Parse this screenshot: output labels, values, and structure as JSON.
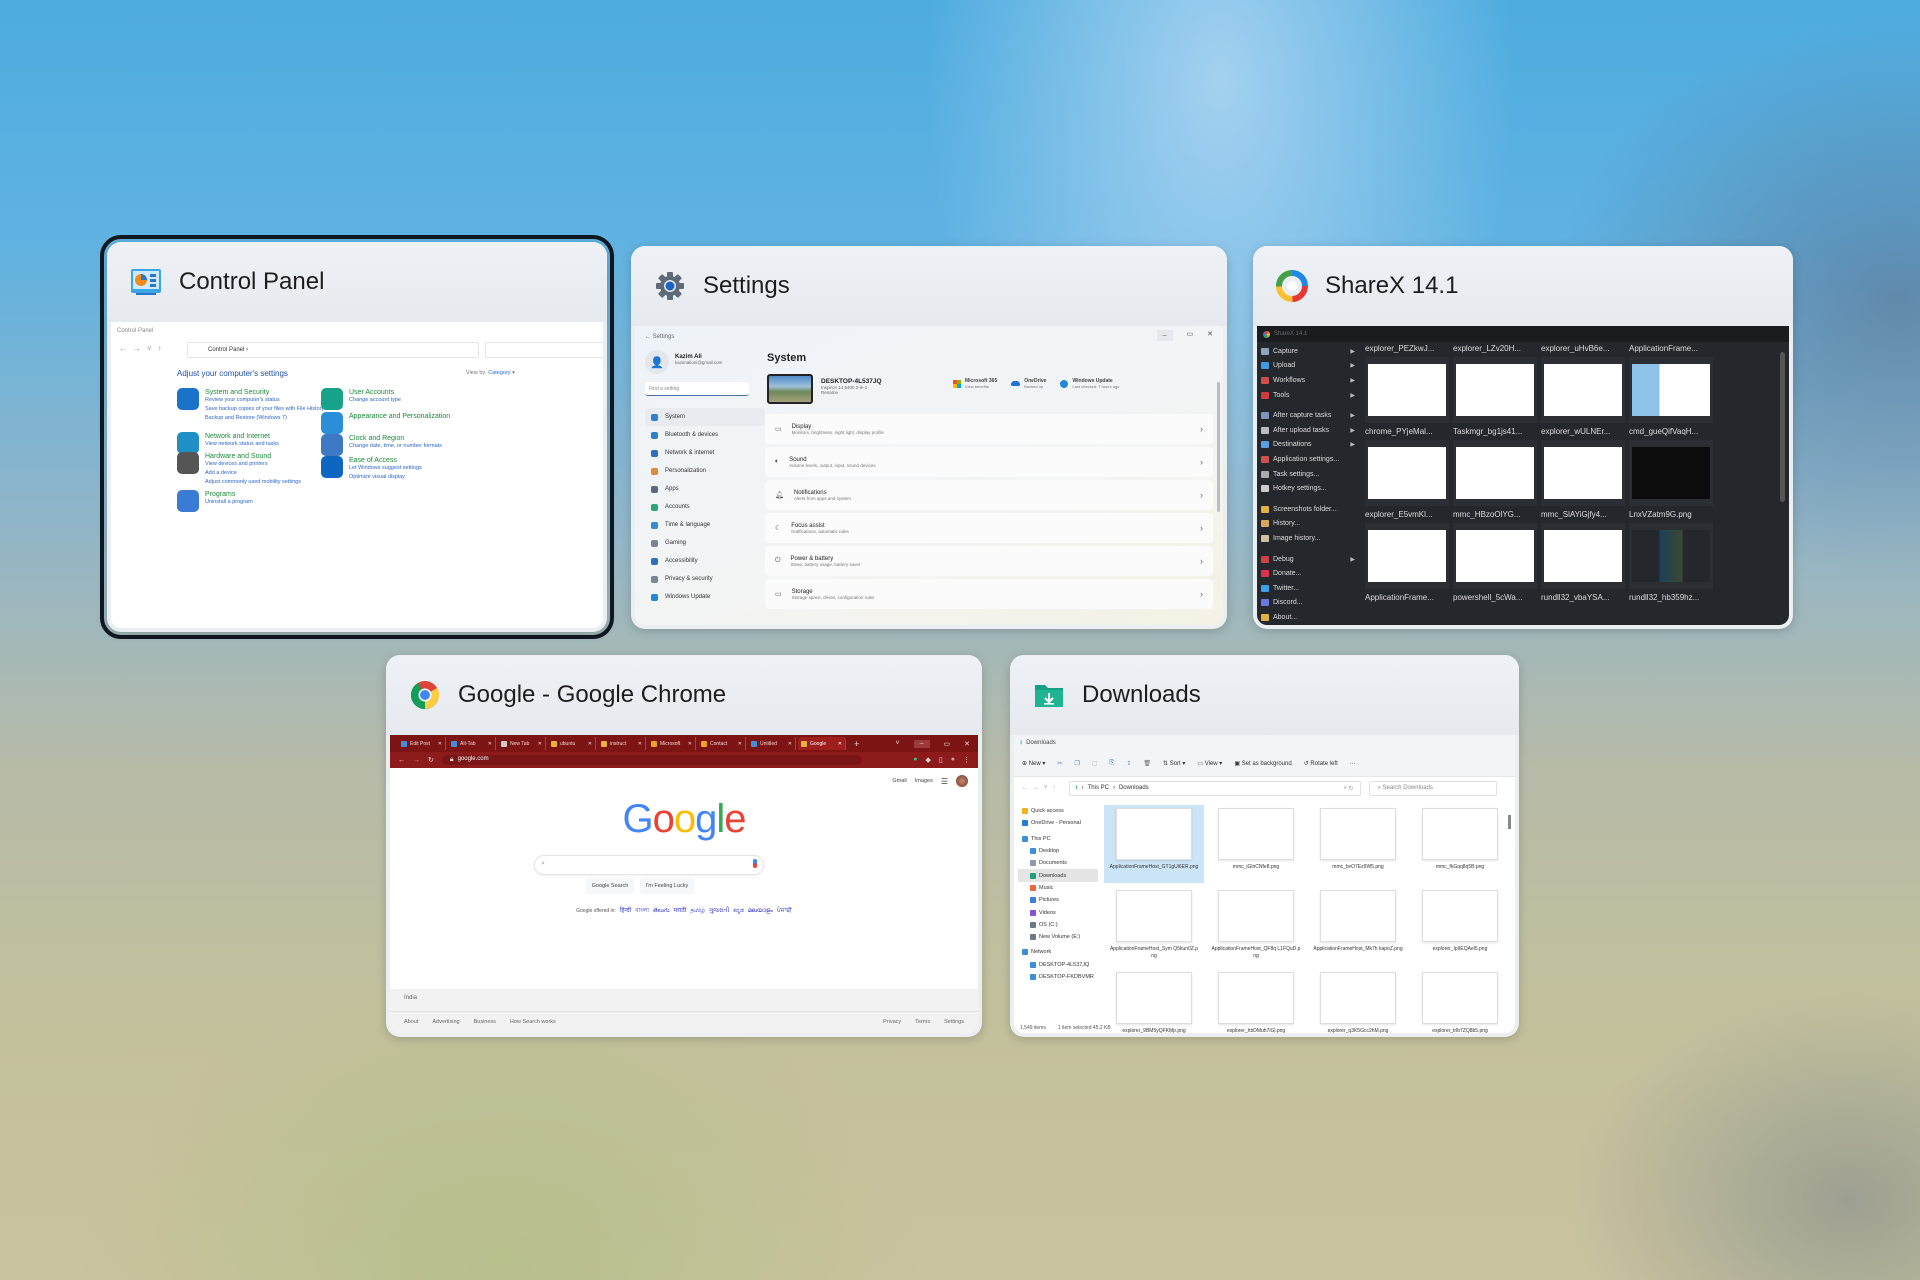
{
  "task_switcher": {
    "windows": [
      {
        "id": "control-panel",
        "title": "Control Panel",
        "selected": true
      },
      {
        "id": "settings",
        "title": "Settings",
        "selected": false
      },
      {
        "id": "sharex",
        "title": "ShareX 14.1",
        "selected": false
      },
      {
        "id": "chrome",
        "title": "Google - Google Chrome",
        "selected": false
      },
      {
        "id": "downloads",
        "title": "Downloads",
        "selected": false
      }
    ]
  },
  "control_panel": {
    "window_title": "Control Panel",
    "breadcrumb": "Control Panel",
    "heading": "Adjust your computer's settings",
    "view_by_label": "View by:",
    "view_by_value": "Category",
    "categories": [
      {
        "name": "System and Security",
        "color": "#1a73c9",
        "links": [
          "Review your computer's status",
          "Save backup copies of your files with File History",
          "Backup and Restore (Windows 7)"
        ]
      },
      {
        "name": "Network and Internet",
        "color": "#1f8fc6",
        "links": [
          "View network status and tasks"
        ]
      },
      {
        "name": "Hardware and Sound",
        "color": "#555555",
        "links": [
          "View devices and printers",
          "Add a device",
          "Adjust commonly used mobility settings"
        ]
      },
      {
        "name": "Programs",
        "color": "#3a7bd5",
        "links": [
          "Uninstall a program"
        ]
      },
      {
        "name": "User Accounts",
        "color": "#17a28a",
        "links": [
          "Change account type"
        ]
      },
      {
        "name": "Appearance and Personalization",
        "color": "#2a8fd8",
        "links": []
      },
      {
        "name": "Clock and Region",
        "color": "#3c78c3",
        "links": [
          "Change date, time, or number formats"
        ]
      },
      {
        "name": "Ease of Access",
        "color": "#0c66c2",
        "links": [
          "Let Windows suggest settings",
          "Optimize visual display"
        ]
      }
    ]
  },
  "settings": {
    "window_title": "Settings",
    "user_name": "Kazim Ali",
    "user_email": "kazimalioni@gmail.com",
    "search_placeholder": "Find a setting",
    "page_title": "System",
    "device_name": "DESKTOP-4L537JQ",
    "device_model": "Inspiron 14 5400 2-in-1",
    "device_rename": "Rename",
    "tiles": [
      {
        "name": "Microsoft 365",
        "sub": "View benefits"
      },
      {
        "name": "OneDrive",
        "sub": "Backed up"
      },
      {
        "name": "Windows Update",
        "sub": "Last checked: 7 hours ago"
      }
    ],
    "nav": [
      {
        "label": "System",
        "color": "#2f7fd1",
        "active": true
      },
      {
        "label": "Bluetooth & devices",
        "color": "#2f7fd1"
      },
      {
        "label": "Network & internet",
        "color": "#2f6fc0"
      },
      {
        "label": "Personalization",
        "color": "#e08a3a"
      },
      {
        "label": "Apps",
        "color": "#5a6a80"
      },
      {
        "label": "Accounts",
        "color": "#2aa677"
      },
      {
        "label": "Time & language",
        "color": "#2f8fd1"
      },
      {
        "label": "Gaming",
        "color": "#7a8595"
      },
      {
        "label": "Accessibility",
        "color": "#2f6fc0"
      },
      {
        "label": "Privacy & security",
        "color": "#7a8595"
      },
      {
        "label": "Windows Update",
        "color": "#1f88d8"
      }
    ],
    "rows": [
      {
        "title": "Display",
        "sub": "Monitors, brightness, night light, display profile"
      },
      {
        "title": "Sound",
        "sub": "Volume levels, output, input, sound devices"
      },
      {
        "title": "Notifications",
        "sub": "Alerts from apps and system"
      },
      {
        "title": "Focus assist",
        "sub": "Notifications, automatic rules"
      },
      {
        "title": "Power & battery",
        "sub": "Sleep, battery usage, battery saver"
      },
      {
        "title": "Storage",
        "sub": "Storage space, drives, configuration rules"
      }
    ]
  },
  "sharex": {
    "window_title": "ShareX 14.1",
    "menu": [
      {
        "label": "Capture",
        "color": "#8fa3bf",
        "arrow": true
      },
      {
        "label": "Upload",
        "color": "#3e9be0",
        "arrow": true
      },
      {
        "label": "Workflows",
        "color": "#d04d4d",
        "arrow": true
      },
      {
        "label": "Tools",
        "color": "#d03a3a",
        "arrow": true
      },
      {
        "sep": true
      },
      {
        "label": "After capture tasks",
        "color": "#7a96c0",
        "arrow": true
      },
      {
        "label": "After upload tasks",
        "color": "#bbbbbb",
        "arrow": true
      },
      {
        "label": "Destinations",
        "color": "#5aa0e0",
        "arrow": true
      },
      {
        "label": "Application settings...",
        "color": "#d05050"
      },
      {
        "label": "Task settings...",
        "color": "#aaaaaa"
      },
      {
        "label": "Hotkey settings...",
        "color": "#cccccc"
      },
      {
        "sep": true
      },
      {
        "label": "Screenshots folder...",
        "color": "#e0b040"
      },
      {
        "label": "History...",
        "color": "#d9a860"
      },
      {
        "label": "Image history...",
        "color": "#d0c0a0"
      },
      {
        "sep": true
      },
      {
        "label": "Debug",
        "color": "#d04040",
        "arrow": true
      },
      {
        "label": "Donate...",
        "color": "#e03050"
      },
      {
        "label": "Twitter...",
        "color": "#3ba0e8"
      },
      {
        "label": "Discord...",
        "color": "#6a78e0"
      },
      {
        "label": "About...",
        "color": "#e0b040"
      }
    ],
    "thumbnails": [
      "explorer_PEZkwJ...",
      "explorer_LZv20H...",
      "explorer_uHvB6e...",
      "ApplicationFrame...",
      "chrome_PYjeMal...",
      "Taskmgr_bg1js41...",
      "explorer_wULNEr...",
      "cmd_gueQifVaqH...",
      "explorer_E5vmKl...",
      "mmc_HBzoOlYG...",
      "mmc_SlAYiGjfy4...",
      "LnxVZatm9G.png",
      "ApplicationFrame...",
      "powershell_5cWa...",
      "rundll32_vbaYSA...",
      "rundll32_hb359hz..."
    ]
  },
  "chrome": {
    "window_title": "Google - Google Chrome",
    "tabs": [
      {
        "label": "Edit Post",
        "color": "#3e8fe0"
      },
      {
        "label": "Alt-Tab",
        "color": "#3e8fe0"
      },
      {
        "label": "New Tab",
        "color": "#cccccc"
      },
      {
        "label": "ubuntu",
        "color": "#e8b040"
      },
      {
        "label": "instruct",
        "color": "#e8b040"
      },
      {
        "label": "Microsoft",
        "color": "#f2a020"
      },
      {
        "label": "Contact",
        "color": "#f2a020"
      },
      {
        "label": "Untitled",
        "color": "#3e8fe0"
      },
      {
        "label": "Google",
        "color": "#e8b040",
        "active": true
      }
    ],
    "url": "google.com",
    "top_links": [
      "Gmail",
      "Images"
    ],
    "logo": [
      {
        "ch": "G",
        "color": "#4285f4"
      },
      {
        "ch": "o",
        "color": "#ea4335"
      },
      {
        "ch": "o",
        "color": "#fbbc05"
      },
      {
        "ch": "g",
        "color": "#4285f4"
      },
      {
        "ch": "l",
        "color": "#34a853"
      },
      {
        "ch": "e",
        "color": "#ea4335"
      }
    ],
    "search_button": "Google Search",
    "lucky_button": "I'm Feeling Lucky",
    "offered_in": "Google offered in:",
    "languages": [
      "हिन्दी",
      "বাংলা",
      "తెలుగు",
      "मराठी",
      "தமிழ்",
      "ગુજરાતી",
      "ಕನ್ನಡ",
      "മലയാളം",
      "ਪੰਜਾਬੀ"
    ],
    "country": "India",
    "footer_left": [
      "About",
      "Advertising",
      "Business",
      "How Search works"
    ],
    "footer_right": [
      "Privacy",
      "Terms",
      "Settings"
    ]
  },
  "downloads": {
    "window_title": "Downloads",
    "toolbar": {
      "new": "New",
      "sort": "Sort",
      "view": "View",
      "set_bg": "Set as background",
      "rotate": "Rotate left",
      "more": "···"
    },
    "path": [
      "This PC",
      "Downloads"
    ],
    "search_placeholder": "Search Downloads",
    "sidebar": [
      {
        "label": "Quick access",
        "color": "#f2b01e"
      },
      {
        "label": "OneDrive - Personal",
        "color": "#1f7fd8"
      },
      {
        "label": "This PC",
        "color": "#3a8fd8"
      },
      {
        "label": "Desktop",
        "color": "#3a8fd8",
        "indent": true
      },
      {
        "label": "Documents",
        "color": "#8a9aaa",
        "indent": true
      },
      {
        "label": "Downloads",
        "color": "#1aa07a",
        "indent": true,
        "active": true
      },
      {
        "label": "Music",
        "color": "#e86a3a",
        "indent": true
      },
      {
        "label": "Pictures",
        "color": "#3a7fd8",
        "indent": true
      },
      {
        "label": "Videos",
        "color": "#8a4fd8",
        "indent": true
      },
      {
        "label": "OS (C:)",
        "color": "#6a7a8a",
        "indent": true
      },
      {
        "label": "New Volume (E:)",
        "color": "#6a7a8a",
        "indent": true
      },
      {
        "label": "Network",
        "color": "#3a8fd8"
      },
      {
        "label": "DESKTOP-4L537JQ",
        "color": "#3a8fd8",
        "indent": true
      },
      {
        "label": "DESKTOP-FKDBVMR",
        "color": "#3a8fd8",
        "indent": true
      }
    ],
    "files": [
      {
        "name": "ApplicationFrameHost_GT1gUi6ER.png",
        "selected": true
      },
      {
        "name": "mmc_iGlnCNfe8.png"
      },
      {
        "name": "mmc_bvO7Ez9W5.png"
      },
      {
        "name": "mmc_fkGqq8q5B.png"
      },
      {
        "name": "ApplicationFrameHost_Sym Q5kun0Z.png"
      },
      {
        "name": "ApplicationFrameHost_QF8q L1FQuD.png"
      },
      {
        "name": "ApplicationFrameHost_Mk7h kapoZ.png"
      },
      {
        "name": "explorer_Ip9EQAel5.png"
      },
      {
        "name": "explorer_9BM5yQFKMp.png"
      },
      {
        "name": "explorer_hbDMuh7iGl.png"
      },
      {
        "name": "explorer_q3K5Gcc2hM.png"
      },
      {
        "name": "explorer_trlb7ZQ8b5.png"
      }
    ],
    "status_items": "1,549 items",
    "status_selected": "1 item selected  45.2 KB"
  }
}
